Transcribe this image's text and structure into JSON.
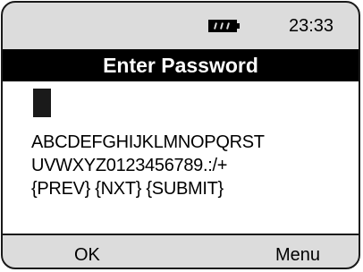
{
  "status": {
    "battery_icon": "battery-full-icon",
    "time": "23:33"
  },
  "screen": {
    "title": "Enter Password",
    "password_value": "",
    "character_lines": [
      "ABCDEFGHIJKLMNOPQRST",
      "UVWXYZ0123456789.:/+",
      "{PREV} {NXT} {SUBMIT}"
    ]
  },
  "softkeys": {
    "left": "OK",
    "right": "Menu"
  }
}
